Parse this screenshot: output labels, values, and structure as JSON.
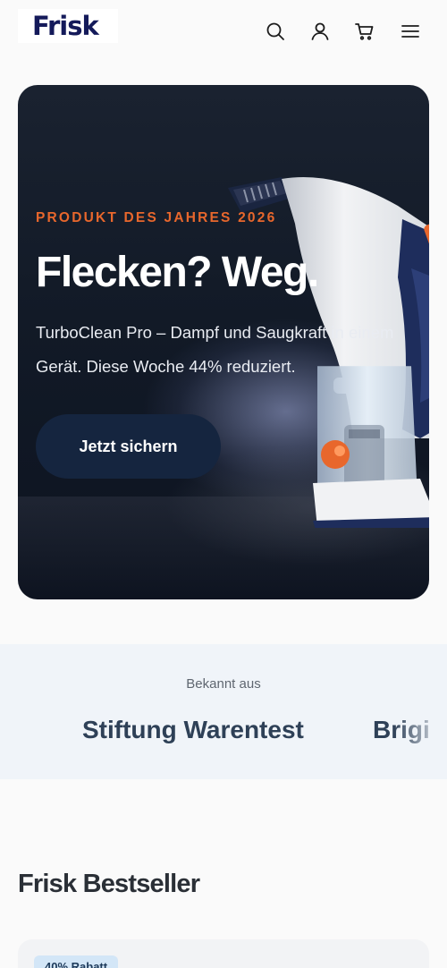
{
  "header": {
    "logo": "Frisk",
    "icons": [
      "search-icon",
      "account-icon",
      "cart-icon",
      "menu-icon"
    ]
  },
  "hero": {
    "eyebrow": "PRODUKT DES JAHRES 2026",
    "headline": "Flecken? Weg.",
    "subtitle": "TurboClean Pro – Dampf und Saugkraft in einem Gerät. Diese Woche 44% reduziert.",
    "cta_label": "Jetzt sichern"
  },
  "press": {
    "label": "Bekannt aus",
    "logos": [
      "Stiftung Warentest",
      "Brigi"
    ]
  },
  "bestsellers": {
    "title": "Frisk Bestseller",
    "badge": "40% Rabatt"
  },
  "colors": {
    "accent": "#e8672c",
    "brand_navy": "#141a5a",
    "cta_bg": "#15253f"
  }
}
